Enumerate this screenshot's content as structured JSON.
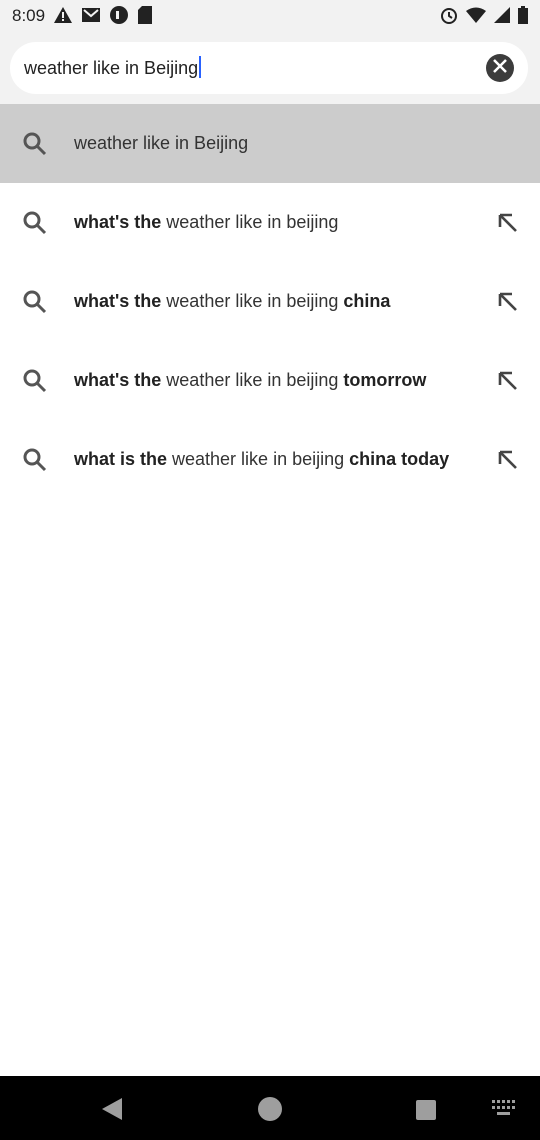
{
  "status_bar": {
    "time": "8:09",
    "left_icons": [
      "warning-icon",
      "gmail-icon",
      "circle-app-icon",
      "sd-card-icon"
    ],
    "right_icons": [
      "alarm-icon",
      "wifi-icon",
      "signal-icon",
      "battery-icon"
    ]
  },
  "search": {
    "query": "weather like in Beijing"
  },
  "suggestions": [
    {
      "prefix": "",
      "middle": "weather like in Beijing",
      "suffix": "",
      "highlighted": true
    },
    {
      "prefix": "what's the ",
      "middle": "weather like in beijing",
      "suffix": ""
    },
    {
      "prefix": "what's the ",
      "middle": "weather like in beijing",
      "suffix": " china"
    },
    {
      "prefix": "what's the ",
      "middle": "weather like in beijing",
      "suffix": " tomorrow"
    },
    {
      "prefix": "what is the ",
      "middle": "weather like in beijing",
      "suffix": " china today"
    }
  ],
  "nav_bar": {
    "icons": [
      "back-icon",
      "home-icon",
      "recents-icon",
      "keyboard-icon"
    ]
  }
}
